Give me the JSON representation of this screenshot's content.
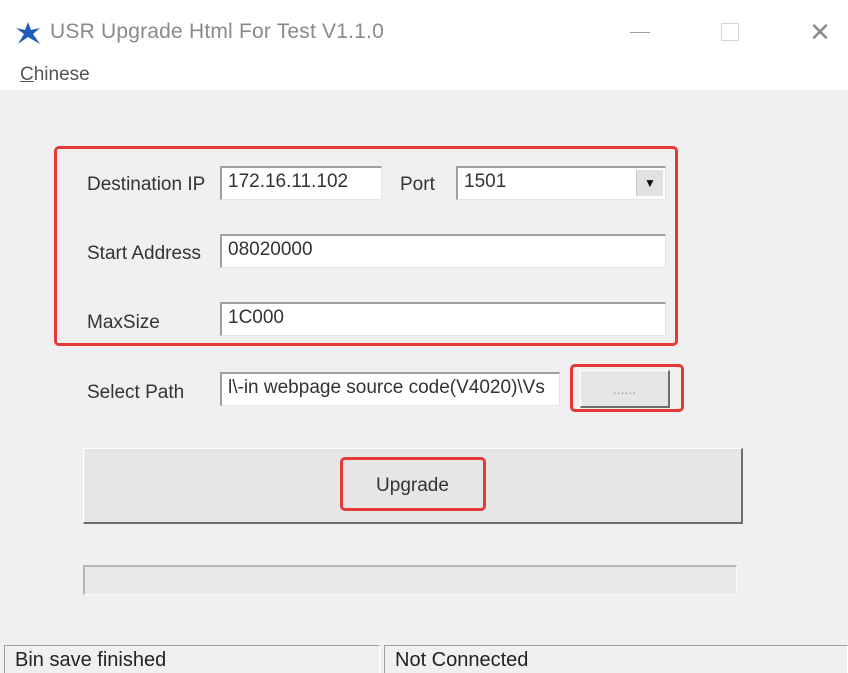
{
  "window": {
    "title": "USR Upgrade Html For Test V1.1.0"
  },
  "title_controls": {
    "minimize_icon": "minimize-icon",
    "maximize_icon": "maximize-icon",
    "close_glyph": "✕"
  },
  "menu": {
    "items": [
      {
        "label_first": "C",
        "label_rest": "hinese"
      }
    ]
  },
  "form": {
    "destination_ip": {
      "label": "Destination IP",
      "value": "172.16.11.102"
    },
    "port": {
      "label": "Port",
      "value": "1501",
      "arrow": "▼"
    },
    "start_address": {
      "label": "Start Address",
      "value": "08020000"
    },
    "max_size": {
      "label": "MaxSize",
      "value": "1C000"
    },
    "select_path": {
      "label": "Select Path",
      "value": "l\\-in webpage source code(V4020)\\Vs"
    },
    "browse_button": {
      "label": "......"
    },
    "upgrade_button": {
      "label": "Upgrade"
    }
  },
  "progress": {
    "value": 0
  },
  "status_bar": {
    "left": "Bin save finished",
    "right": "Not Connected"
  },
  "colors": {
    "highlight": "#e53935",
    "app_icon": "#1e5bb8"
  }
}
